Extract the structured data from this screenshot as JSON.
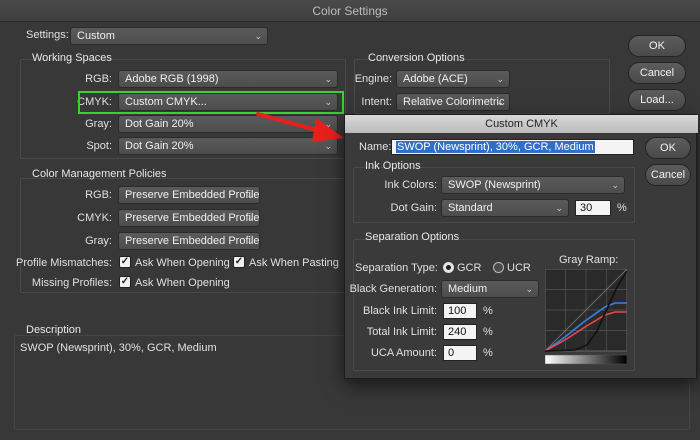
{
  "window": {
    "title": "Color Settings"
  },
  "settings": {
    "label": "Settings:",
    "value": "Custom"
  },
  "buttons": {
    "ok": "OK",
    "cancel": "Cancel",
    "load": "Load..."
  },
  "working_spaces": {
    "title": "Working Spaces",
    "rgb": {
      "label": "RGB:",
      "value": "Adobe RGB (1998)"
    },
    "cmyk": {
      "label": "CMYK:",
      "value": "Custom CMYK..."
    },
    "gray": {
      "label": "Gray:",
      "value": "Dot Gain 20%"
    },
    "spot": {
      "label": "Spot:",
      "value": "Dot Gain 20%"
    }
  },
  "conversion": {
    "title": "Conversion Options",
    "engine": {
      "label": "Engine:",
      "value": "Adobe (ACE)"
    },
    "intent": {
      "label": "Intent:",
      "value": "Relative Colorimetric"
    }
  },
  "policies": {
    "title": "Color Management Policies",
    "rgb": {
      "label": "RGB:",
      "value": "Preserve Embedded Profiles"
    },
    "cmyk": {
      "label": "CMYK:",
      "value": "Preserve Embedded Profiles"
    },
    "gray": {
      "label": "Gray:",
      "value": "Preserve Embedded Profiles"
    },
    "mismatches": {
      "label": "Profile Mismatches:",
      "opening": "Ask When Opening",
      "pasting": "Ask When Pasting"
    },
    "missing": {
      "label": "Missing Profiles:",
      "opening": "Ask When Opening"
    }
  },
  "description": {
    "title": "Description",
    "text": "SWOP (Newsprint), 30%, GCR, Medium"
  },
  "custom_cmyk": {
    "title": "Custom CMYK",
    "name_label": "Name:",
    "name_value": "SWOP (Newsprint), 30%, GCR, Medium",
    "ok": "OK",
    "cancel": "Cancel",
    "ink_options": {
      "title": "Ink Options",
      "ink_colors_label": "Ink Colors:",
      "ink_colors_value": "SWOP (Newsprint)",
      "dot_gain_label": "Dot Gain:",
      "dot_gain_value": "Standard",
      "dot_gain_amount": "30",
      "percent": "%"
    },
    "separation": {
      "title": "Separation Options",
      "type_label": "Separation Type:",
      "gcr": "GCR",
      "ucr": "UCR",
      "black_gen_label": "Black Generation:",
      "black_gen_value": "Medium",
      "black_limit_label": "Black Ink Limit:",
      "black_limit_value": "100",
      "total_limit_label": "Total Ink Limit:",
      "total_limit_value": "240",
      "uca_label": "UCA Amount:",
      "uca_value": "0",
      "percent": "%",
      "gray_ramp_label": "Gray Ramp:"
    }
  },
  "colors": {
    "highlight": "#39d22f",
    "arrow": "#e8201c",
    "selection": "#2f6fc9"
  }
}
